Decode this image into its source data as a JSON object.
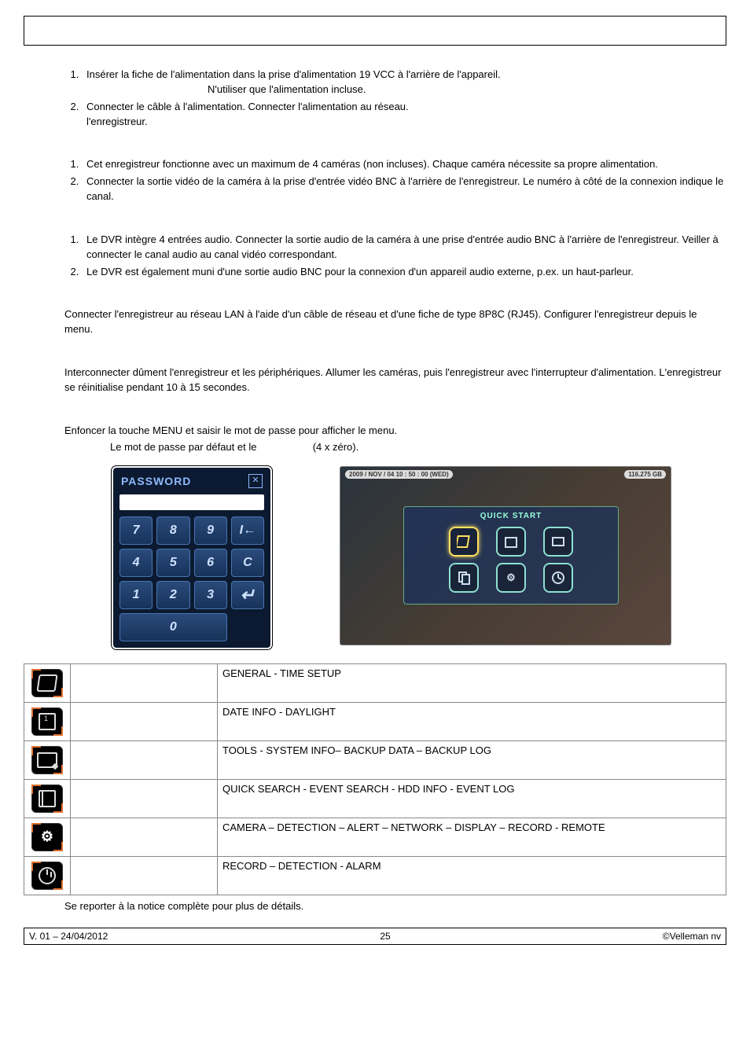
{
  "list1": [
    {
      "t": "Insérer la fiche de l'alimentation dans la prise d'alimentation 19 VCC à l'arrière de l'appareil.",
      "t2": "N'utiliser que l'alimentation incluse."
    },
    {
      "t": "Connecter le câble à l'alimentation. Connecter l'alimentation au réseau.",
      "t3": "l'enregistreur."
    }
  ],
  "list2": [
    {
      "t": "Cet enregistreur fonctionne avec un maximum de 4 caméras (non incluses). Chaque caméra nécessite sa propre alimentation."
    },
    {
      "t": "Connecter la sortie vidéo de la caméra à la prise d'entrée vidéo BNC à l'arrière de l'enregistreur. Le numéro à côté de la connexion indique le canal."
    }
  ],
  "list3": [
    {
      "t": "Le DVR intègre 4 entrées audio. Connecter la sortie audio de la caméra à une prise d'entrée audio BNC à l'arrière de l'enregistreur. Veiller à connecter le canal audio au canal vidéo correspondant."
    },
    {
      "t": "Le DVR est également muni d'une sortie audio BNC pour la connexion d'un appareil audio externe, p.ex. un haut-parleur."
    }
  ],
  "lan": "Connecter l'enregistreur au réseau LAN à l'aide d'un câble de réseau et d'une fiche de type 8P8C (RJ45). Configurer l'enregistreur depuis le menu.",
  "power": "Interconnecter dûment l'enregistreur et les périphériques. Allumer les caméras, puis l'enregistreur avec l'interrupteur d'alimentation. L'enregistreur se réinitialise pendant 10 à 15 secondes.",
  "menu1": "Enfoncer la touche MENU et saisir le mot de passe pour afficher le menu.",
  "menu2a": "Le mot de passe par défaut et le ",
  "menu2b": " (4 x zéro).",
  "pwd": "PASSWORD",
  "qtitle": "QUICK START",
  "qdate": "2009 / NOV / 04 10 : 50 : 00 (WED)",
  "qgb": "116.275 GB",
  "rows": [
    {
      "d": "GENERAL - TIME SETUP"
    },
    {
      "d": "DATE INFO - DAYLIGHT"
    },
    {
      "d": "TOOLS - SYSTEM INFO– BACKUP DATA – BACKUP LOG"
    },
    {
      "d": "QUICK SEARCH - EVENT SEARCH - HDD INFO - EVENT LOG"
    },
    {
      "d": "CAMERA – DETECTION – ALERT – NETWORK – DISPLAY – RECORD - REMOTE"
    },
    {
      "d": "RECORD – DETECTION - ALARM"
    }
  ],
  "foot": "Se reporter à la notice complète pour plus de détails.",
  "ver": "V. 01 – 24/04/2012",
  "pg": "25",
  "cc": "©Velleman nv"
}
